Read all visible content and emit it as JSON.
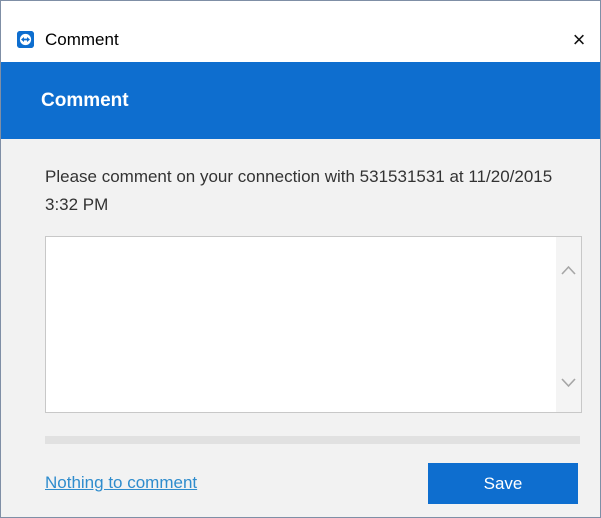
{
  "window": {
    "title": "Comment",
    "close_glyph": "×",
    "app_icon": "teamviewer-logo-icon"
  },
  "header": {
    "title": "Comment"
  },
  "main": {
    "prompt": "Please comment on your connection with 531531531 at 11/20/2015 3:32 PM",
    "comment_value": "",
    "scroll_up_icon": "chevron-up-icon",
    "scroll_down_icon": "chevron-down-icon"
  },
  "footer": {
    "link_label": "Nothing to comment",
    "save_label": "Save"
  },
  "colors": {
    "accent": "#0e6ecf",
    "link": "#2e8ccd",
    "panel": "#f2f2f2",
    "divider": "#e1e1e1"
  }
}
